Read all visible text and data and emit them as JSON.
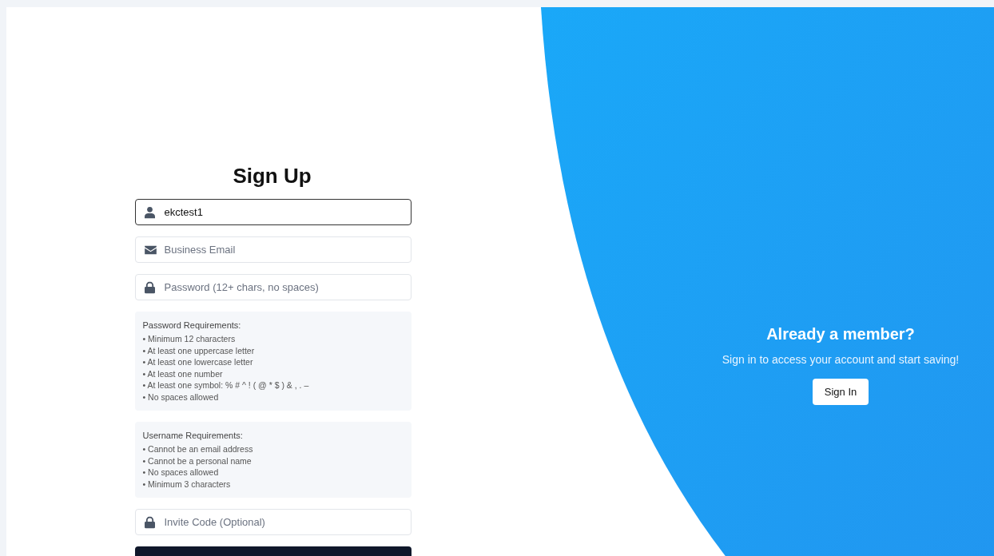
{
  "form": {
    "title": "Sign Up",
    "fields": [
      {
        "kind": "user",
        "value": "ekctest1",
        "focused": true
      },
      {
        "kind": "email",
        "placeholder": "Business Email",
        "focused": false
      },
      {
        "kind": "lock",
        "placeholder": "Password (12+ chars, no spaces)",
        "focused": false
      }
    ],
    "requirement_boxes": [
      {
        "heading": "Password Requirements:",
        "items": [
          "• Minimum 12 characters",
          "• At least one uppercase letter",
          "• At least one lowercase letter",
          "• At least one number",
          "• At least one symbol: % # ^ ! ( @ * $ ) & , . –",
          "• No spaces allowed"
        ]
      },
      {
        "heading": "Username Requirements:",
        "items": [
          "• Cannot be an email address",
          "• Cannot be a personal name",
          "• No spaces allowed",
          "• Minimum 3 characters"
        ]
      }
    ],
    "invite_field": {
      "kind": "lock",
      "placeholder": "Invite Code (Optional)"
    }
  },
  "side_panel": {
    "heading": "Already a member?",
    "text": "Sign in to access your account and start saving!",
    "button": "Sign In"
  }
}
